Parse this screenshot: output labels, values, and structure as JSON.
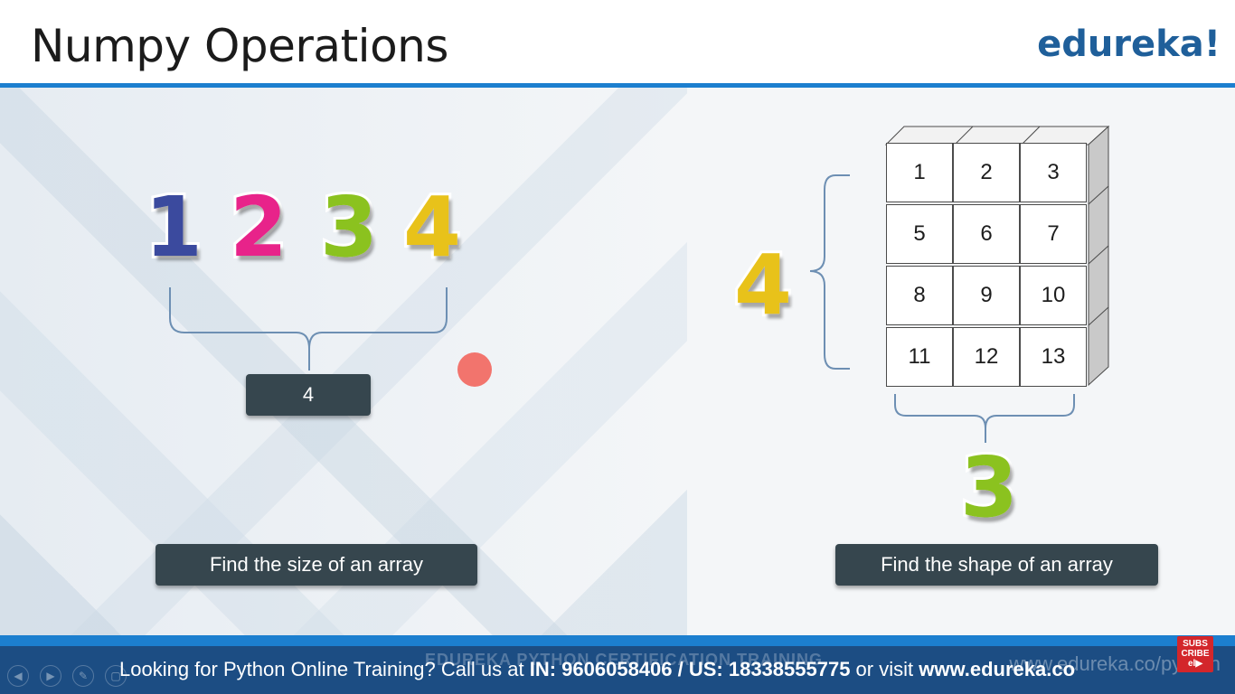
{
  "slide": {
    "title": "Numpy Operations",
    "logo": "edureka!"
  },
  "left_panel": {
    "digits": [
      {
        "text": "1",
        "color": "#3b4a9e"
      },
      {
        "text": "2",
        "color": "#e8238a"
      },
      {
        "text": "3",
        "color": "#8bc21f"
      },
      {
        "text": "4",
        "color": "#e8c21a"
      }
    ],
    "result_value": "4",
    "caption": "Find the size of an array"
  },
  "right_panel": {
    "rows_label": "4",
    "cols_label": "3",
    "rows_color": "#e8c21a",
    "cols_color": "#8bc21f",
    "grid": [
      [
        "1",
        "2",
        "3"
      ],
      [
        "5",
        "6",
        "7"
      ],
      [
        "8",
        "9",
        "10"
      ],
      [
        "11",
        "12",
        "13"
      ]
    ],
    "caption": "Find the shape of an array"
  },
  "footer": {
    "prefix": "Looking for Python Online Training? Call us at ",
    "phones": "IN: 9606058406 / US: 18338555775",
    "middle": " or visit ",
    "url": "www.edureka.co",
    "ghost_text": "EDUREKA PYTHON CERTIFICATION TRAINING",
    "ghost_url": "www.edureka.co/python",
    "subscribe_top": "SUBS",
    "subscribe_mid": "CRIBE",
    "subscribe_bottom": "el▶"
  },
  "player_controls": [
    "◀",
    "▶",
    "✎",
    "▢"
  ]
}
